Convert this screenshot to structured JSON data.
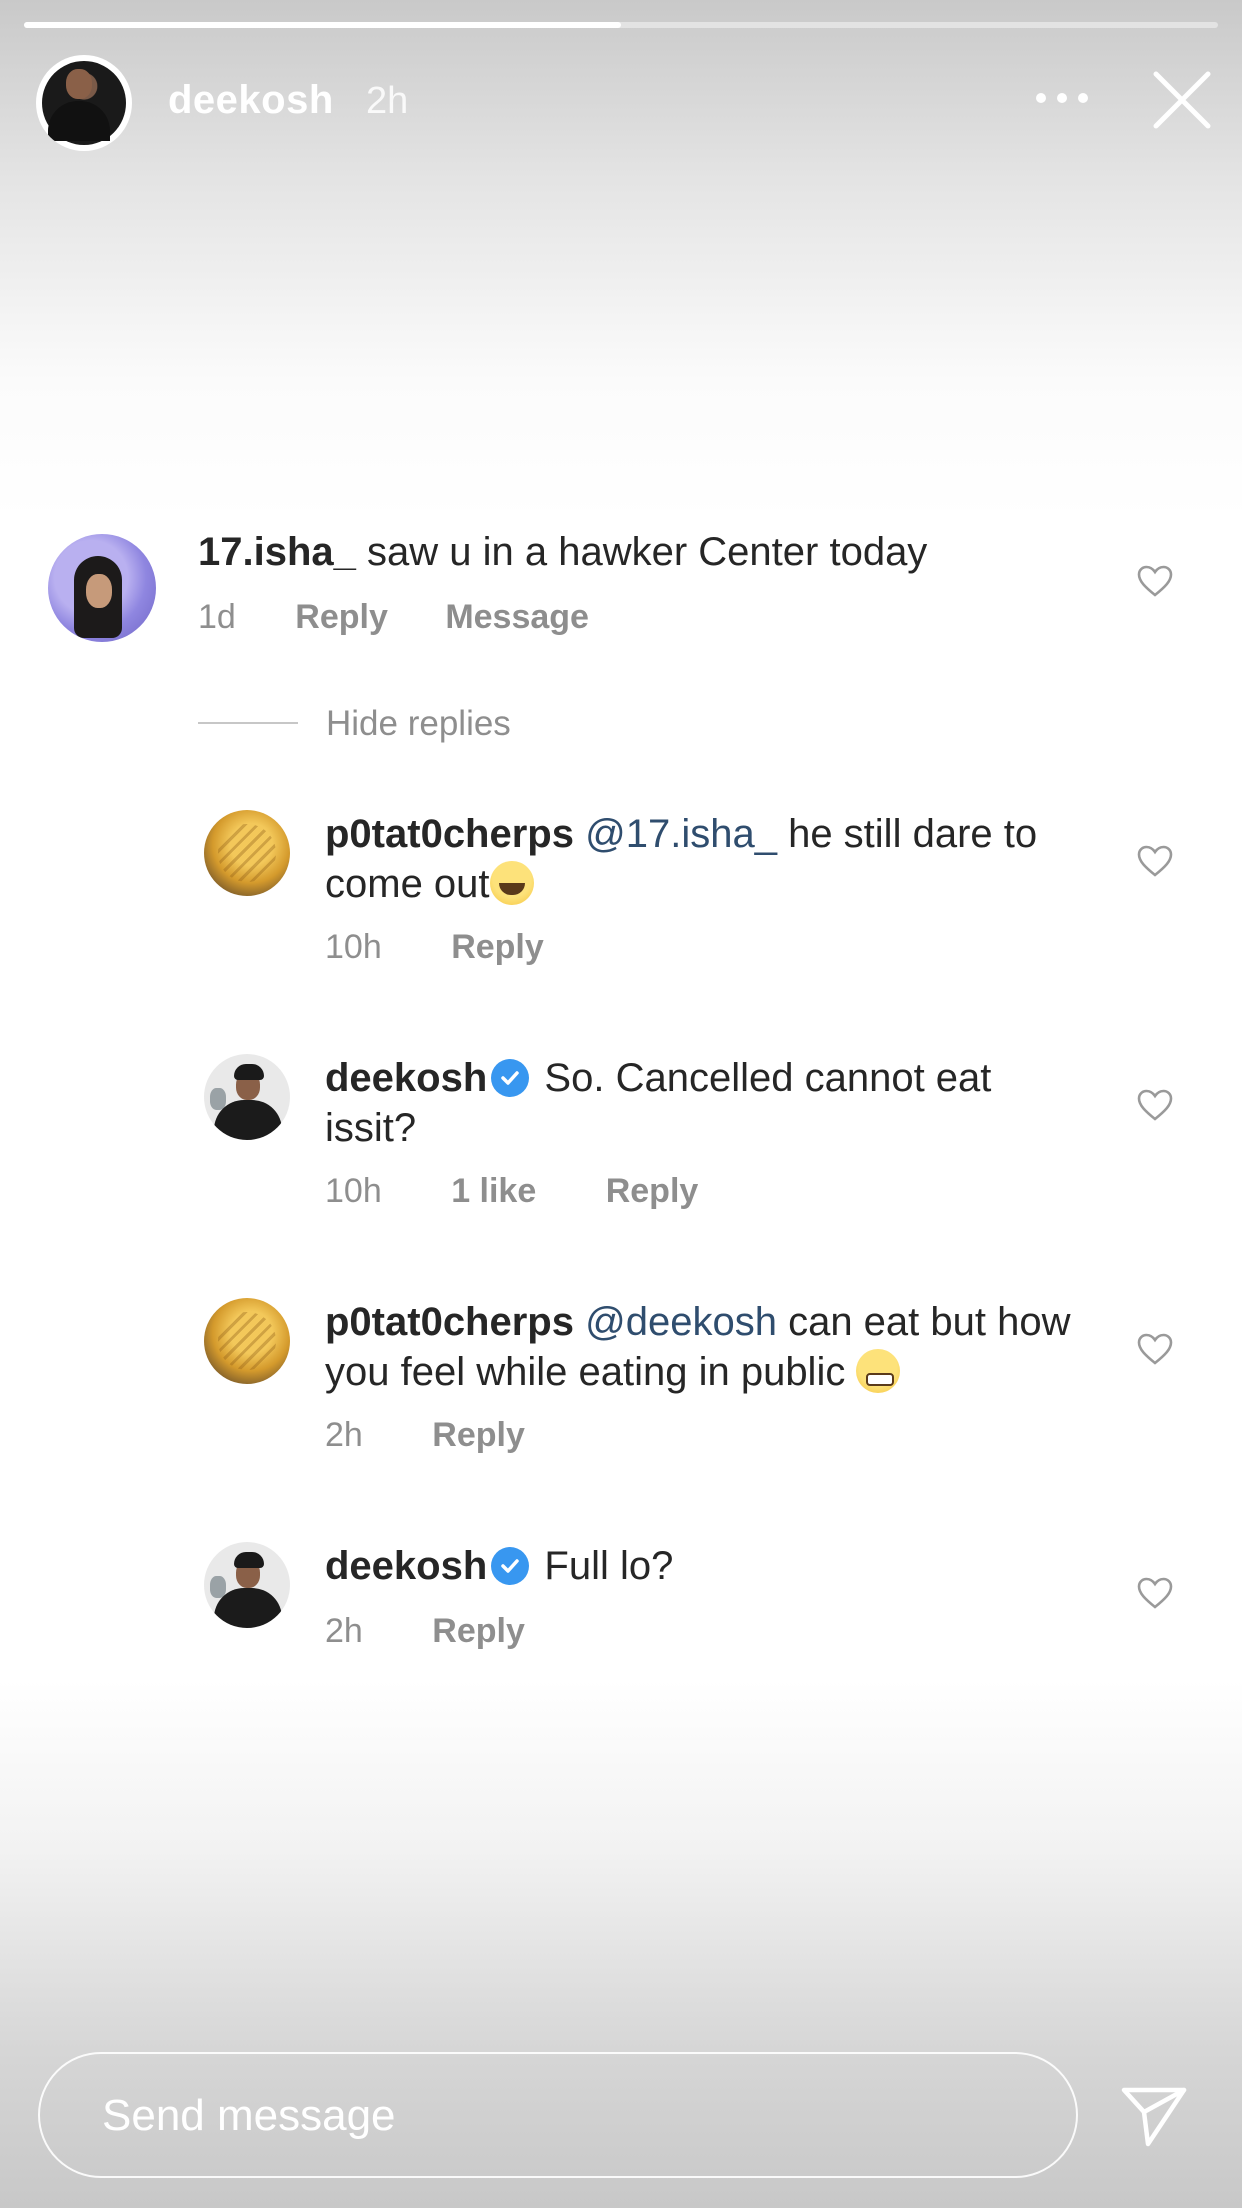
{
  "story": {
    "progress_fraction": 0.5,
    "username": "deekosh",
    "time": "2h"
  },
  "comments": [
    {
      "username": "17.isha_",
      "text": "saw u in a hawker Center today",
      "time": "1d",
      "reply_label": "Reply",
      "message_label": "Message"
    },
    {
      "username": "p0tat0cherps",
      "mention": "@17.isha_",
      "text_line1": "he still dare to",
      "text_line2": "come out",
      "emoji": "grinning-squinting-face",
      "time": "10h",
      "reply_label": "Reply"
    },
    {
      "username": "deekosh",
      "verified": true,
      "text_line1": "So. Cancelled cannot eat",
      "text_line2": "issit?",
      "time": "10h",
      "likes": "1 like",
      "reply_label": "Reply"
    },
    {
      "username": "p0tat0cherps",
      "mention": "@deekosh",
      "text_line1": "can eat but how",
      "text_line2": "you feel while eating in public",
      "emoji": "grimacing-face",
      "time": "2h",
      "reply_label": "Reply"
    },
    {
      "username": "deekosh",
      "verified": true,
      "text": "Full lo?",
      "time": "2h",
      "reply_label": "Reply"
    }
  ],
  "hide_replies": "Hide replies",
  "composer": {
    "placeholder": "Send message"
  },
  "colors": {
    "verified": "#3897f0",
    "mention": "#2f4d6e",
    "meta": "#8e8e8e"
  }
}
